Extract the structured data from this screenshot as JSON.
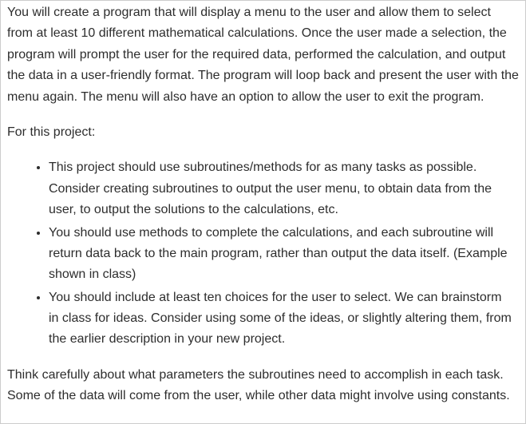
{
  "paragraphs": {
    "intro": "You will create a program that will display a menu to the user and allow them to select from at least 10 different mathematical calculations. Once the user made a selection, the program will prompt the user for the required data, performed the calculation, and output the data in a user-friendly format. The program will loop back and present the user with the menu again. The menu will also have an option to allow the user to exit the program.",
    "for_project_label": "For this project:",
    "conclusion": "Think carefully about what parameters the subroutines need to accomplish in each task. Some of the data will come from the user, while other data might involve using constants."
  },
  "bullets": [
    "This project should use subroutines/methods for as many tasks as possible. Consider creating subroutines to output the user menu, to obtain data from the user, to output the solutions to the calculations, etc.",
    "You should use methods to complete the calculations, and each subroutine will return data back to the main program, rather than output the data itself. (Example shown in class)",
    "You should include at least ten choices for the user to select.  We can brainstorm in class for ideas. Consider using some of the ideas, or slightly altering them, from the earlier description in your new project."
  ]
}
